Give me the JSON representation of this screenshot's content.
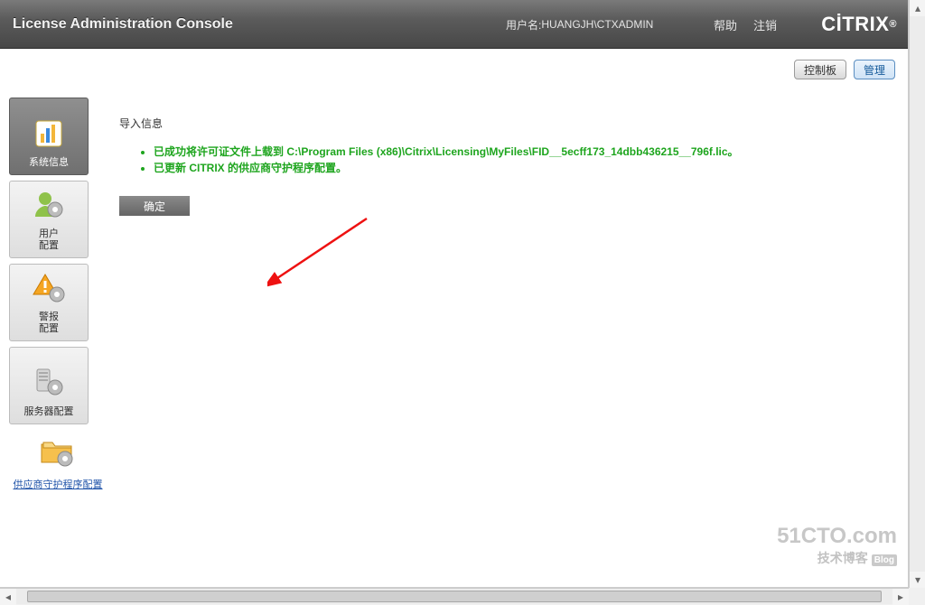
{
  "header": {
    "app_title": "License Administration Console",
    "user_label": "用户名: ",
    "user_name": "HUANGJH\\CTXADMIN",
    "help": "帮助",
    "logout": "注销",
    "brand": "CİTRIX"
  },
  "top_actions": {
    "dashboard": "控制板",
    "admin": "管理"
  },
  "sidebar": {
    "items": [
      {
        "label": "系统信息"
      },
      {
        "label": "用户\n配置"
      },
      {
        "label": "警报\n配置"
      },
      {
        "label": "服务器配置"
      }
    ],
    "extra": {
      "label": "供应商守护程序配置"
    }
  },
  "main": {
    "section_title": "导入信息",
    "messages": [
      "已成功将许可证文件上载到 C:\\Program Files (x86)\\Citrix\\Licensing\\MyFiles\\FID__5ecff173_14dbb436215__796f.lic。",
      "已更新 CITRIX 的供应商守护程序配置。"
    ],
    "ok_label": "确定"
  },
  "watermark": {
    "line1": "51CTO.com",
    "line2": "技术博客",
    "badge": "Blog"
  }
}
